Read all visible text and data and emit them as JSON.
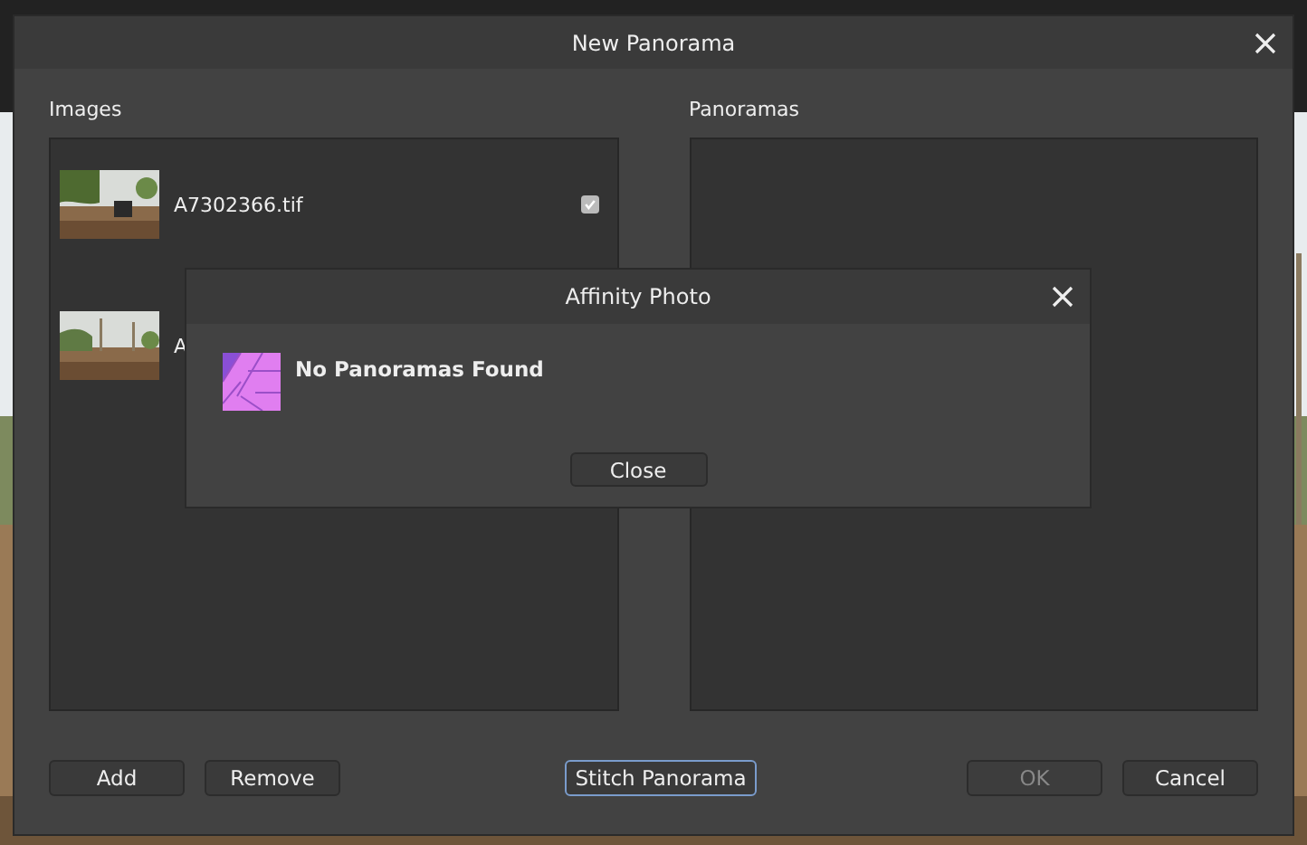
{
  "dialog": {
    "title": "New Panorama",
    "images": {
      "label": "Images",
      "items": [
        {
          "name": "A7302366.tif",
          "checked": true
        },
        {
          "name": "A"
        }
      ]
    },
    "panoramas": {
      "label": "Panoramas"
    },
    "buttons": [
      {
        "label": "Add",
        "disabled": false,
        "focused": false
      },
      {
        "label": "Remove",
        "disabled": false,
        "focused": false
      },
      {
        "label": "Stitch Panorama",
        "disabled": false,
        "focused": true
      },
      {
        "label": "OK",
        "disabled": true,
        "focused": false
      },
      {
        "label": "Cancel",
        "disabled": false,
        "focused": false
      }
    ]
  },
  "alert": {
    "title": "Affinity Photo",
    "message": "No Panoramas Found",
    "button": "Close"
  }
}
